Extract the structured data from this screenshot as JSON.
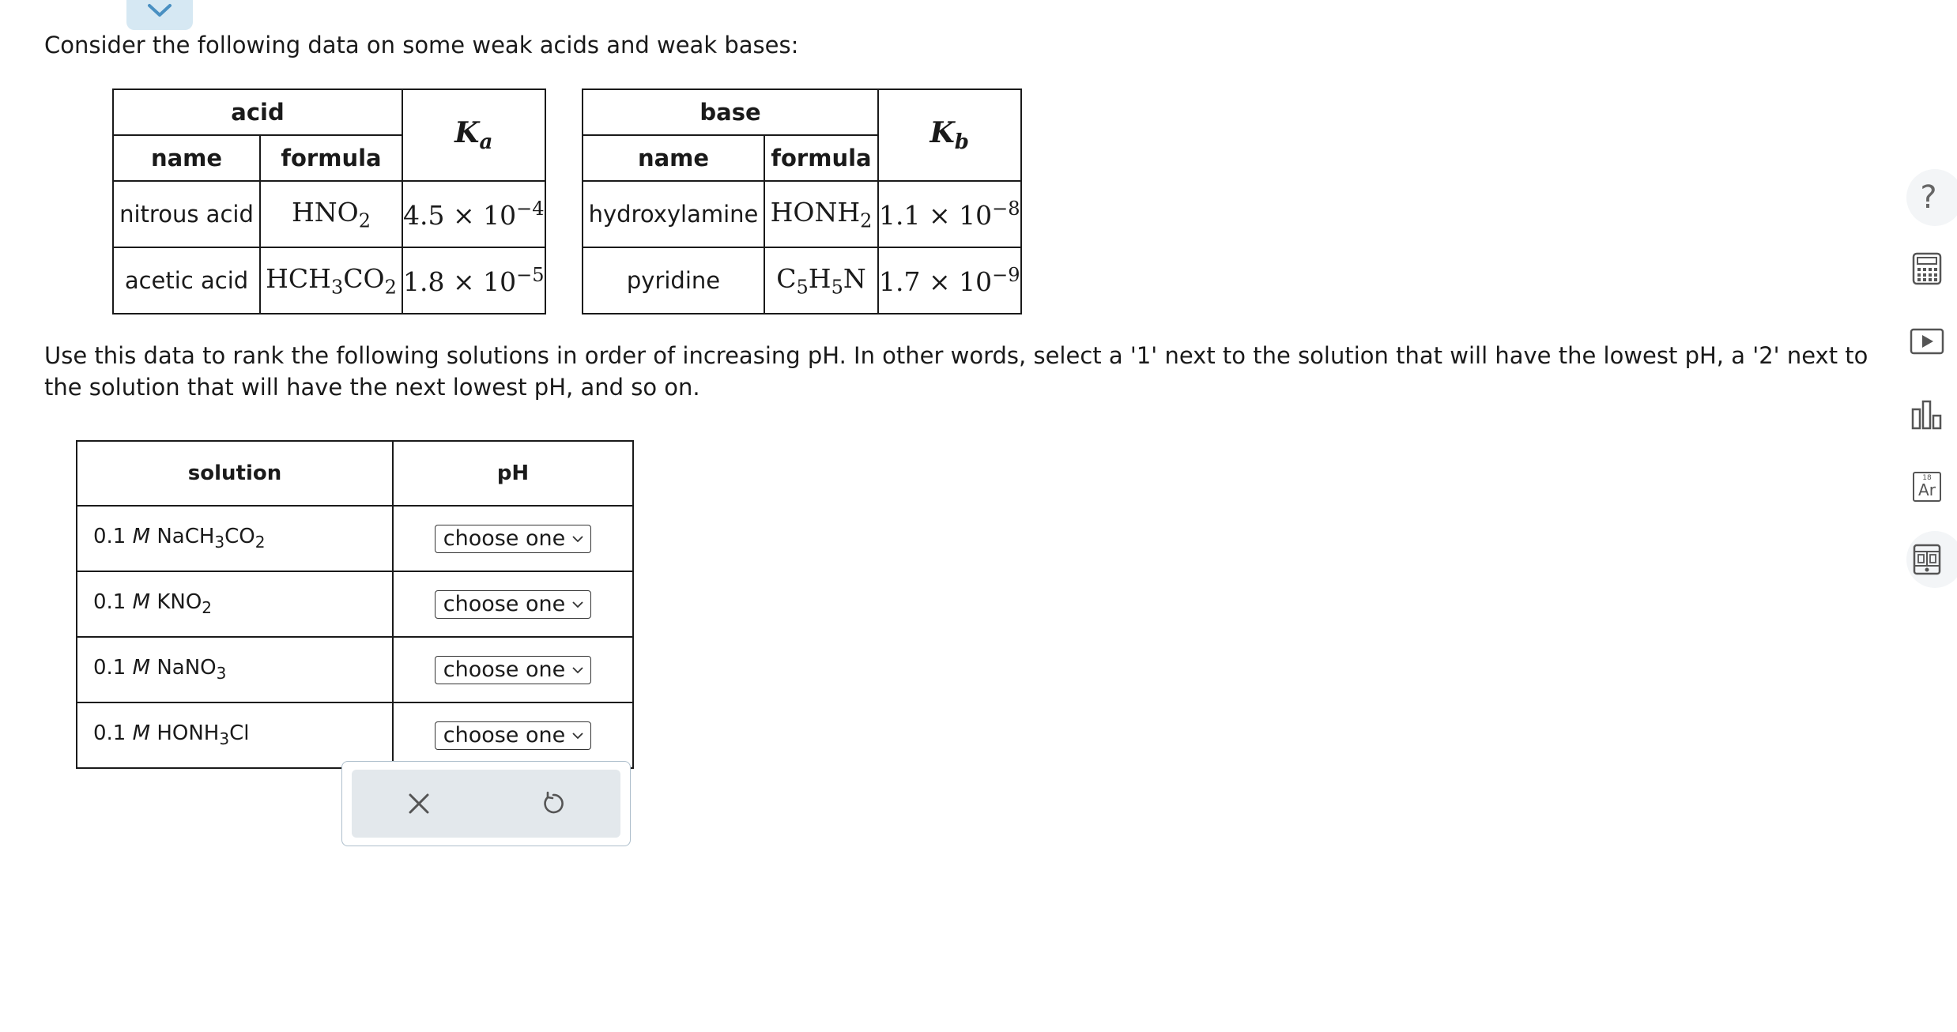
{
  "intro": "Consider the following data on some weak acids and weak bases:",
  "acid_table": {
    "group_header": "acid",
    "name_header": "name",
    "formula_header": "formula",
    "k_symbol": "K",
    "k_subscript": "a",
    "rows": [
      {
        "name": "nitrous acid",
        "formula_parts": [
          "HNO",
          "2",
          ""
        ],
        "mantissa": "4.5 × 10",
        "exponent": "−4"
      },
      {
        "name": "acetic acid",
        "formula_parts": [
          "HCH",
          "3",
          "CO",
          "2",
          ""
        ],
        "mantissa": "1.8 × 10",
        "exponent": "−5"
      }
    ]
  },
  "base_table": {
    "group_header": "base",
    "name_header": "name",
    "formula_header": "formula",
    "k_symbol": "K",
    "k_subscript": "b",
    "rows": [
      {
        "name": "hydroxylamine",
        "formula_parts": [
          "HONH",
          "2",
          ""
        ],
        "mantissa": "1.1 × 10",
        "exponent": "−8"
      },
      {
        "name": "pyridine",
        "formula_parts": [
          "C",
          "5",
          "H",
          "5",
          "N"
        ],
        "mantissa": "1.7 × 10",
        "exponent": "−9"
      }
    ]
  },
  "prompt": "Use this data to rank the following solutions in order of increasing pH. In other words, select a '1' next to the solution that will have the lowest pH, a '2' next to the solution that will have the next lowest pH, and so on.",
  "ranking_table": {
    "solution_header": "solution",
    "ph_header": "pH",
    "rows": [
      {
        "conc": "0.1 ",
        "unit": "M",
        "formula_parts": [
          " NaCH",
          "3",
          "CO",
          "2",
          ""
        ],
        "selected": "choose one"
      },
      {
        "conc": "0.1 ",
        "unit": "M",
        "formula_parts": [
          " KNO",
          "2",
          ""
        ],
        "selected": "choose one"
      },
      {
        "conc": "0.1 ",
        "unit": "M",
        "formula_parts": [
          " NaNO",
          "3",
          ""
        ],
        "selected": "choose one"
      },
      {
        "conc": "0.1 ",
        "unit": "M",
        "formula_parts": [
          " HONH",
          "3",
          "Cl"
        ],
        "selected": "choose one"
      }
    ]
  },
  "toolbar": {
    "help_glyph": "?",
    "periodic_symbol": "Ar",
    "periodic_number": "18"
  },
  "colors": {
    "tab_bg": "#d6e8f3",
    "accent": "#4a90c2",
    "action_bg": "#e3e8ec",
    "icon_gray": "#555555"
  },
  "icons": [
    "chevron-down-icon",
    "close-icon",
    "undo-icon",
    "help-icon",
    "calculator-icon",
    "video-icon",
    "bar-chart-icon",
    "periodic-table-icon",
    "data-reference-icon"
  ]
}
